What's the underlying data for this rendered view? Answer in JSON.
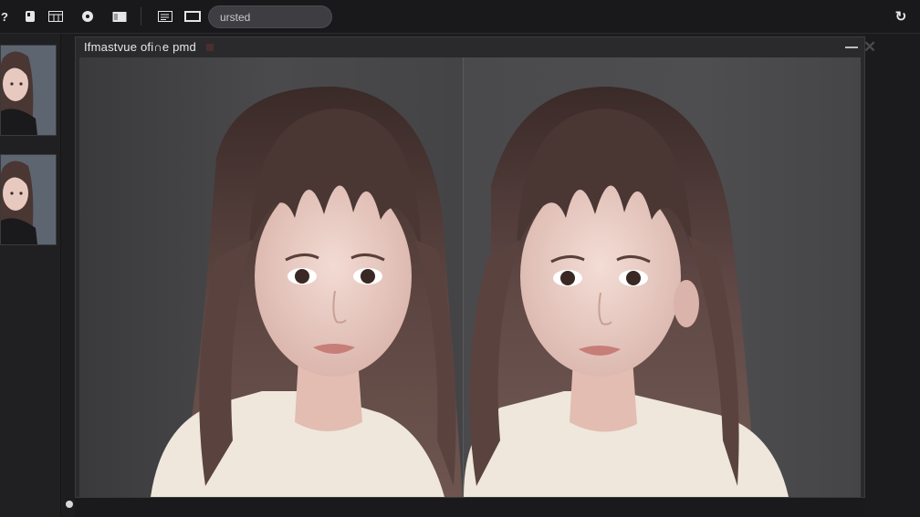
{
  "toolbar": {
    "buttons": [
      {
        "name": "help-icon",
        "glyph": "?"
      },
      {
        "name": "bookmark-icon",
        "glyph": "▮"
      },
      {
        "name": "grid-icon",
        "glyph": "▦"
      },
      {
        "name": "settings-icon",
        "glyph": "●"
      },
      {
        "name": "folder-icon",
        "glyph": "◧"
      },
      {
        "name": "list-icon",
        "glyph": "▤"
      },
      {
        "name": "window-icon",
        "glyph": "▭"
      }
    ],
    "search_value": "ursted",
    "right_icon": "refresh-icon",
    "right_glyph": "↻"
  },
  "panel": {
    "title": "Ifmastvue ofi∩e pmd",
    "minimize_glyph": "–",
    "close_glyph": "✕"
  },
  "colors": {
    "background": "#1d1d1f",
    "panel": "#2a2a2c",
    "viewer": "#3c3c3e",
    "hair": "#4a3734",
    "skin": "#e8c9c0",
    "shirt": "#efe7dc"
  }
}
